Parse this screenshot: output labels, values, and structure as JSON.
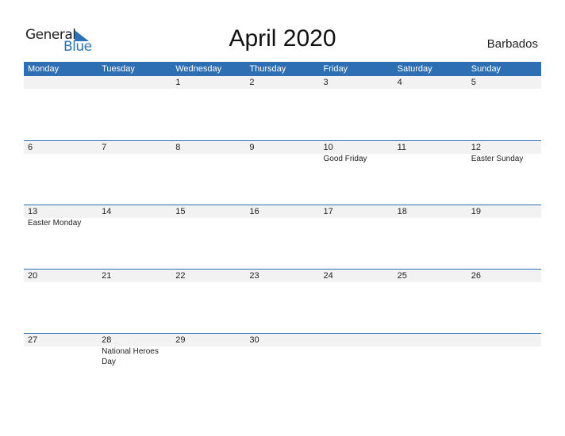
{
  "logo": {
    "line1": "General",
    "line2": "Blue"
  },
  "title": "April 2020",
  "country": "Barbados",
  "colors": {
    "header_bg": "#2e6fb3",
    "logo_blue": "#2b72b8",
    "date_band": "#f2f2f2"
  },
  "weekdays": [
    "Monday",
    "Tuesday",
    "Wednesday",
    "Thursday",
    "Friday",
    "Saturday",
    "Sunday"
  ],
  "weeks": [
    [
      {
        "day": "",
        "event": ""
      },
      {
        "day": "",
        "event": ""
      },
      {
        "day": "1",
        "event": ""
      },
      {
        "day": "2",
        "event": ""
      },
      {
        "day": "3",
        "event": ""
      },
      {
        "day": "4",
        "event": ""
      },
      {
        "day": "5",
        "event": ""
      }
    ],
    [
      {
        "day": "6",
        "event": ""
      },
      {
        "day": "7",
        "event": ""
      },
      {
        "day": "8",
        "event": ""
      },
      {
        "day": "9",
        "event": ""
      },
      {
        "day": "10",
        "event": "Good Friday"
      },
      {
        "day": "11",
        "event": ""
      },
      {
        "day": "12",
        "event": "Easter Sunday"
      }
    ],
    [
      {
        "day": "13",
        "event": "Easter Monday"
      },
      {
        "day": "14",
        "event": ""
      },
      {
        "day": "15",
        "event": ""
      },
      {
        "day": "16",
        "event": ""
      },
      {
        "day": "17",
        "event": ""
      },
      {
        "day": "18",
        "event": ""
      },
      {
        "day": "19",
        "event": ""
      }
    ],
    [
      {
        "day": "20",
        "event": ""
      },
      {
        "day": "21",
        "event": ""
      },
      {
        "day": "22",
        "event": ""
      },
      {
        "day": "23",
        "event": ""
      },
      {
        "day": "24",
        "event": ""
      },
      {
        "day": "25",
        "event": ""
      },
      {
        "day": "26",
        "event": ""
      }
    ],
    [
      {
        "day": "27",
        "event": ""
      },
      {
        "day": "28",
        "event": "National Heroes Day"
      },
      {
        "day": "29",
        "event": ""
      },
      {
        "day": "30",
        "event": ""
      },
      {
        "day": "",
        "event": ""
      },
      {
        "day": "",
        "event": ""
      },
      {
        "day": "",
        "event": ""
      }
    ]
  ]
}
